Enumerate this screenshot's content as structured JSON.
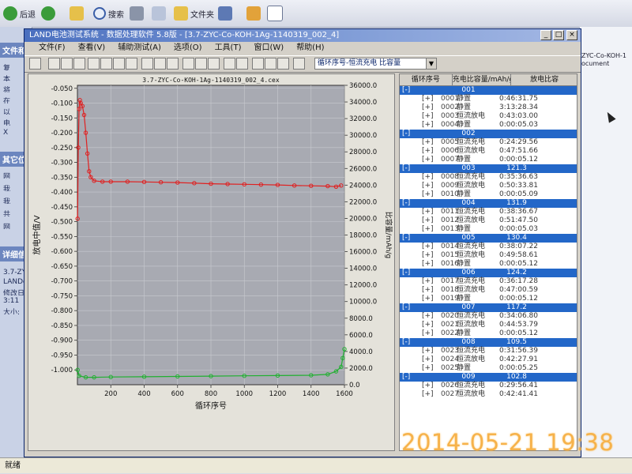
{
  "explorer": {
    "back_label": "后退",
    "search_label": "搜索",
    "folders_label": "文件夹",
    "side_blocks": [
      "文件和",
      "其它位",
      "详细信"
    ],
    "side_lines": [
      "复",
      "本",
      "将",
      "在",
      "以",
      "电",
      "X",
      "网",
      "我",
      "我",
      "共",
      "网"
    ],
    "detail_lines": [
      "3.7-ZY",
      "LANDdt",
      "修改日",
      "3:11",
      "大小:"
    ],
    "right_text": [
      "ZYC-Co-KOH-1",
      "ocument"
    ]
  },
  "window": {
    "title": "LAND电池测试系统 - 数据处理软件 5.8版 - [3.7-ZYC-Co-KOH-1Ag-1140319_002_4]",
    "min": "_",
    "max": "□",
    "close": "×"
  },
  "menu": [
    "文件(F)",
    "查看(V)",
    "辅助测试(A)",
    "选项(O)",
    "工具(T)",
    "窗口(W)",
    "帮助(H)"
  ],
  "toolbar": {
    "curve_select": "循环序号-恒流充电 比容量"
  },
  "chart_data": {
    "type": "line",
    "title": "3.7-ZYC-Co-KOH-1Ag-1140319_002_4.cex",
    "xlabel": "循环序号",
    "ylabel": "放电中值/V",
    "y2label": "比容量/mAh/g",
    "x_ticks": [
      200,
      400,
      600,
      800,
      1000,
      1200,
      1400,
      1600
    ],
    "xlim": [
      0,
      1600
    ],
    "y_ticks": [
      -0.05,
      -0.1,
      -0.15,
      -0.2,
      -0.25,
      -0.3,
      -0.35,
      -0.4,
      -0.45,
      -0.5,
      -0.55,
      -0.6,
      -0.65,
      -0.7,
      -0.75,
      -0.8,
      -0.85,
      -0.9,
      -0.95,
      -1.0
    ],
    "ylim": [
      -1.05,
      -0.04
    ],
    "y2_ticks": [
      0,
      2000,
      4000,
      6000,
      8000,
      10000,
      12000,
      14000,
      16000,
      18000,
      20000,
      22000,
      24000,
      26000,
      28000,
      30000,
      32000,
      34000,
      36000
    ],
    "y2lim": [
      0,
      36000
    ],
    "y_tick_labels": [
      "-0.050",
      "-0.100",
      "-0.150",
      "-0.200",
      "-0.250",
      "-0.300",
      "-0.350",
      "-0.400",
      "-0.450",
      "-0.500",
      "-0.550",
      "-0.600",
      "-0.650",
      "-0.700",
      "-0.750",
      "-0.800",
      "-0.850",
      "-0.900",
      "-0.950",
      "-1.000"
    ],
    "y2_tick_labels": [
      "0.0",
      "2000.0",
      "4000.0",
      "6000.0",
      "8000.0",
      "10000.0",
      "12000.0",
      "14000.0",
      "16000.0",
      "18000.0",
      "20000.0",
      "22000.0",
      "24000.0",
      "26000.0",
      "28000.0",
      "30000.0",
      "32000.0",
      "34000.0",
      "36000.0"
    ],
    "grid": true,
    "series": [
      {
        "color": "#e02020",
        "axis": "left",
        "x": [
          1,
          5,
          10,
          15,
          20,
          30,
          40,
          50,
          60,
          70,
          80,
          100,
          150,
          200,
          300,
          400,
          500,
          600,
          700,
          800,
          900,
          1000,
          1100,
          1200,
          1300,
          1400,
          1500,
          1550,
          1580
        ],
        "y": [
          -0.49,
          -0.25,
          -0.12,
          -0.09,
          -0.1,
          -0.11,
          -0.14,
          -0.2,
          -0.27,
          -0.33,
          -0.35,
          -0.362,
          -0.365,
          -0.365,
          -0.365,
          -0.366,
          -0.367,
          -0.368,
          -0.37,
          -0.372,
          -0.373,
          -0.374,
          -0.375,
          -0.376,
          -0.378,
          -0.379,
          -0.38,
          -0.382,
          -0.378
        ]
      },
      {
        "color": "#20b030",
        "axis": "left",
        "x": [
          1,
          10,
          50,
          100,
          200,
          400,
          600,
          800,
          1000,
          1200,
          1400,
          1500,
          1550,
          1580,
          1590,
          1600
        ],
        "y": [
          -1.0,
          -1.02,
          -1.025,
          -1.025,
          -1.024,
          -1.023,
          -1.022,
          -1.021,
          -1.02,
          -1.019,
          -1.018,
          -1.015,
          -1.005,
          -0.99,
          -0.96,
          -0.93
        ]
      }
    ]
  },
  "list": {
    "headers": [
      "循环序号",
      "充电比容量/mAh/g",
      "放电比容"
    ],
    "groups": [
      {
        "id": "001",
        "value": "",
        "rows": [
          [
            "0001",
            "静置",
            "0:46:31.75"
          ],
          [
            "0002",
            "静置",
            "3:13:28.34"
          ],
          [
            "0003",
            "恒流放电",
            "0:43:03.00"
          ],
          [
            "0004",
            "静置",
            "0:00:05.03"
          ]
        ]
      },
      {
        "id": "002",
        "value": "",
        "rows": [
          [
            "0005",
            "恒流充电",
            "0:24:29.56"
          ],
          [
            "0006",
            "恒流放电",
            "0:47:51.66"
          ],
          [
            "0007",
            "静置",
            "0:00:05.12"
          ]
        ]
      },
      {
        "id": "003",
        "value": "121.3",
        "rows": [
          [
            "0008",
            "恒流充电",
            "0:35:36.63"
          ],
          [
            "0009",
            "恒流放电",
            "0:50:33.81"
          ],
          [
            "0010",
            "静置",
            "0:00:05.09"
          ]
        ]
      },
      {
        "id": "004",
        "value": "131.9",
        "rows": [
          [
            "0011",
            "恒流充电",
            "0:38:36.67"
          ],
          [
            "0012",
            "恒流放电",
            "0:51:47.50"
          ],
          [
            "0013",
            "静置",
            "0:00:05.03"
          ]
        ]
      },
      {
        "id": "005",
        "value": "130.4",
        "rows": [
          [
            "0014",
            "恒流充电",
            "0:38:07.22"
          ],
          [
            "0015",
            "恒流放电",
            "0:49:58.61"
          ],
          [
            "0016",
            "静置",
            "0:00:05.12"
          ]
        ]
      },
      {
        "id": "006",
        "value": "124.2",
        "rows": [
          [
            "0017",
            "恒流充电",
            "0:36:17.28"
          ],
          [
            "0018",
            "恒流放电",
            "0:47:00.59"
          ],
          [
            "0019",
            "静置",
            "0:00:05.12"
          ]
        ]
      },
      {
        "id": "007",
        "value": "117.2",
        "rows": [
          [
            "0020",
            "恒流充电",
            "0:34:06.80"
          ],
          [
            "0021",
            "恒流放电",
            "0:44:53.79"
          ],
          [
            "0022",
            "静置",
            "0:00:05.12"
          ]
        ]
      },
      {
        "id": "008",
        "value": "109.5",
        "rows": [
          [
            "0023",
            "恒流充电",
            "0:31:56.39"
          ],
          [
            "0024",
            "恒流放电",
            "0:42:27.91"
          ],
          [
            "0025",
            "静置",
            "0:00:05.25"
          ]
        ]
      },
      {
        "id": "009",
        "value": "102.8",
        "rows": [
          [
            "0026",
            "恒流充电",
            "0:29:56.41"
          ],
          [
            "0027",
            "恒流放电",
            "0:42:41.41"
          ]
        ]
      }
    ]
  },
  "status": "就绪",
  "photo_timestamp": "2014-05-21 19:38",
  "colors": {
    "plot_bg": "#a8aab2",
    "group_bar": "#2367c8",
    "red_series": "#e02020",
    "green_series": "#20b030"
  }
}
